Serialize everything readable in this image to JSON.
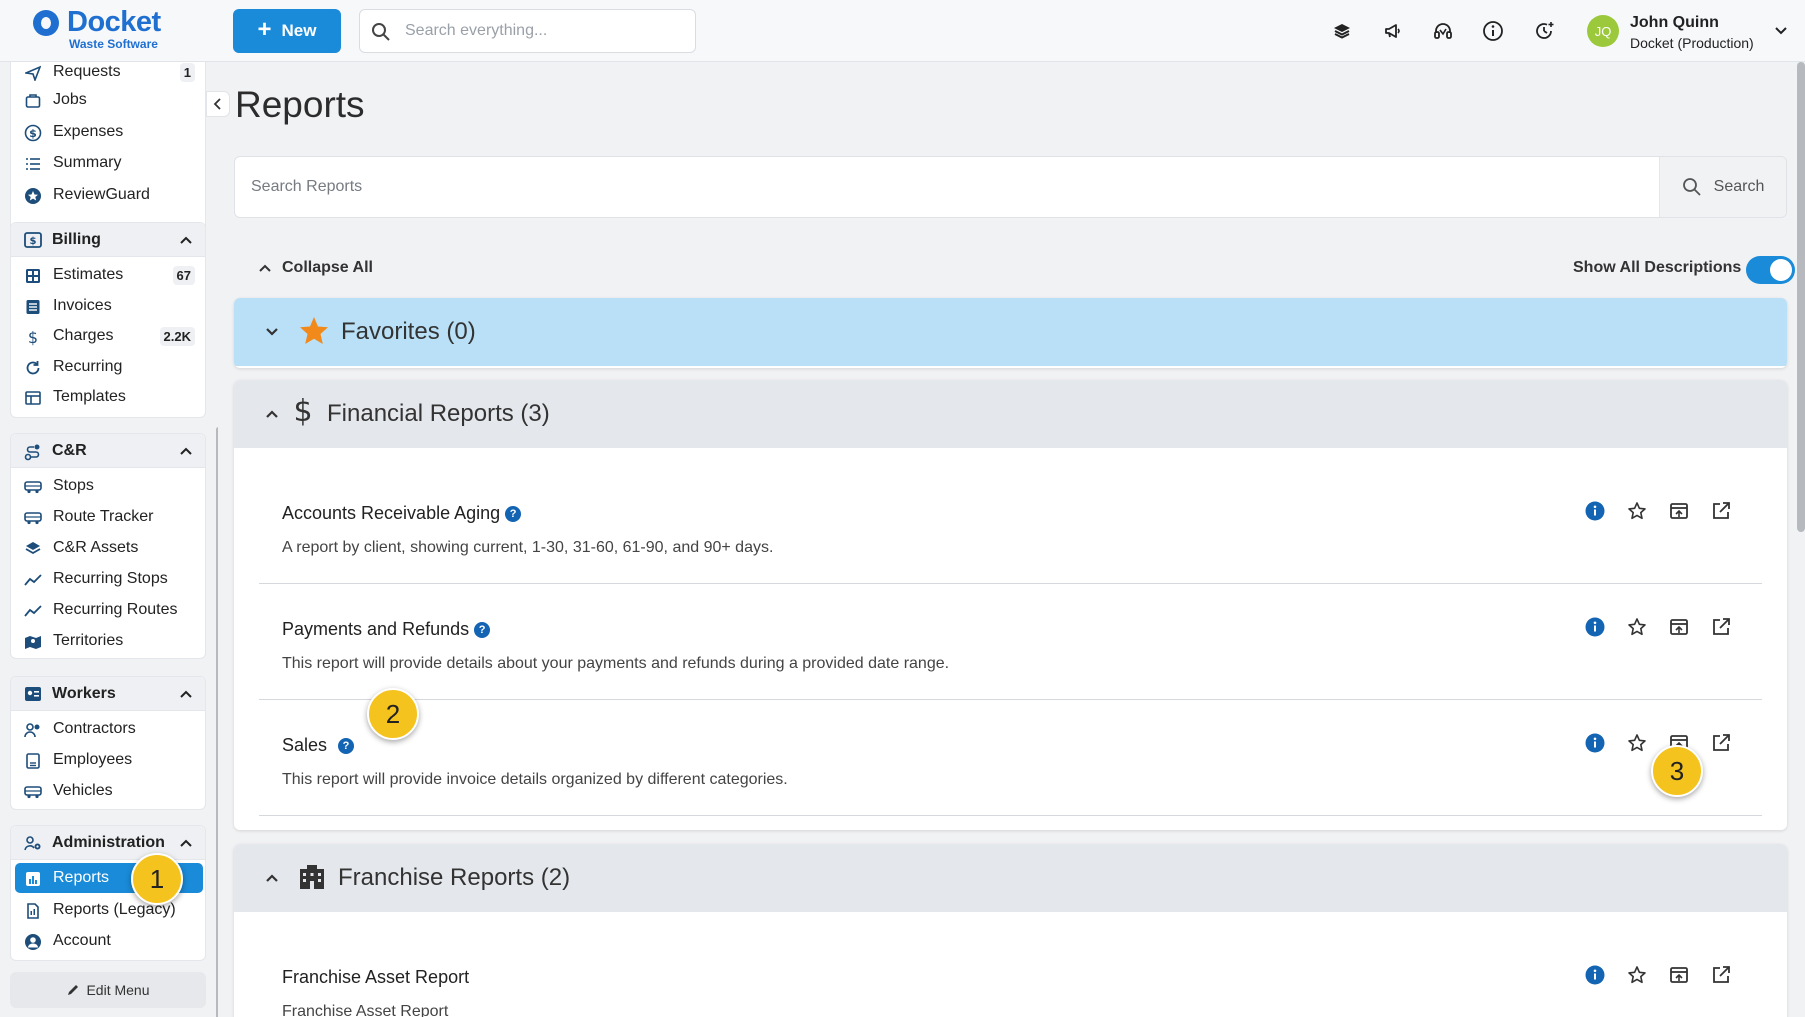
{
  "app": {
    "logo_name": "Docket",
    "logo_sub": "Waste Software",
    "new_button": "New",
    "search_placeholder": "Search everything...",
    "brand_color": "#1f6fd1",
    "accent_color": "#1a8bd8"
  },
  "user": {
    "initials": "JQ",
    "name": "John Quinn",
    "org": "Docket (Production)"
  },
  "top_icons": [
    "layers-icon",
    "megaphone-icon",
    "headset-icon",
    "info-icon",
    "history-icon"
  ],
  "sidebar": {
    "top_items": [
      {
        "label": "Requests",
        "icon": "send-icon",
        "badge": "1"
      },
      {
        "label": "Jobs",
        "icon": "jobs-icon"
      },
      {
        "label": "Expenses",
        "icon": "dollar-circle-icon"
      },
      {
        "label": "Summary",
        "icon": "list-icon"
      },
      {
        "label": "ReviewGuard",
        "icon": "star-circle-icon"
      }
    ],
    "billing": {
      "title": "Billing",
      "items": [
        {
          "label": "Estimates",
          "icon": "calculator-icon",
          "badge": "67"
        },
        {
          "label": "Invoices",
          "icon": "invoice-icon"
        },
        {
          "label": "Charges",
          "icon": "dollar-icon",
          "badge": "2.2K"
        },
        {
          "label": "Recurring",
          "icon": "refresh-icon"
        },
        {
          "label": "Templates",
          "icon": "table-icon"
        }
      ]
    },
    "cr": {
      "title": "C&R",
      "items": [
        {
          "label": "Stops",
          "icon": "truck-icon"
        },
        {
          "label": "Route Tracker",
          "icon": "truck-icon"
        },
        {
          "label": "C&R Assets",
          "icon": "layers-icon"
        },
        {
          "label": "Recurring Stops",
          "icon": "trend-icon"
        },
        {
          "label": "Recurring Routes",
          "icon": "trend-icon"
        },
        {
          "label": "Territories",
          "icon": "map-icon"
        }
      ]
    },
    "workers": {
      "title": "Workers",
      "items": [
        {
          "label": "Contractors",
          "icon": "users-icon"
        },
        {
          "label": "Employees",
          "icon": "id-icon"
        },
        {
          "label": "Vehicles",
          "icon": "truck-icon"
        }
      ]
    },
    "administration": {
      "title": "Administration",
      "items": [
        {
          "label": "Reports",
          "icon": "chart-icon",
          "active": true
        },
        {
          "label": "Reports (Legacy)",
          "icon": "document-icon"
        },
        {
          "label": "Account",
          "icon": "account-icon"
        }
      ]
    },
    "edit_menu": "Edit Menu"
  },
  "main": {
    "title": "Reports",
    "search_placeholder": "Search Reports",
    "search_button": "Search",
    "collapse_all": "Collapse All",
    "show_descriptions": "Show All Descriptions",
    "show_descriptions_on": true,
    "sections": {
      "favorites": {
        "label": "Favorites (0)",
        "expanded": false
      },
      "financial": {
        "label": "Financial Reports (3)",
        "expanded": true,
        "reports": [
          {
            "title": "Accounts Receivable Aging",
            "desc": "A report by client, showing current, 1-30, 31-60, 61-90, and 90+ days."
          },
          {
            "title": "Payments and Refunds",
            "desc": "This report will provide details about your payments and refunds during a provided date range."
          },
          {
            "title": "Sales",
            "desc": "This report will provide invoice details organized by different categories."
          }
        ]
      },
      "franchise": {
        "label": "Franchise Reports (2)",
        "expanded": true,
        "reports": [
          {
            "title": "Franchise Asset Report",
            "desc": "Franchise Asset Report"
          }
        ]
      }
    }
  },
  "markers": {
    "one": "1",
    "two": "2",
    "three": "3"
  }
}
